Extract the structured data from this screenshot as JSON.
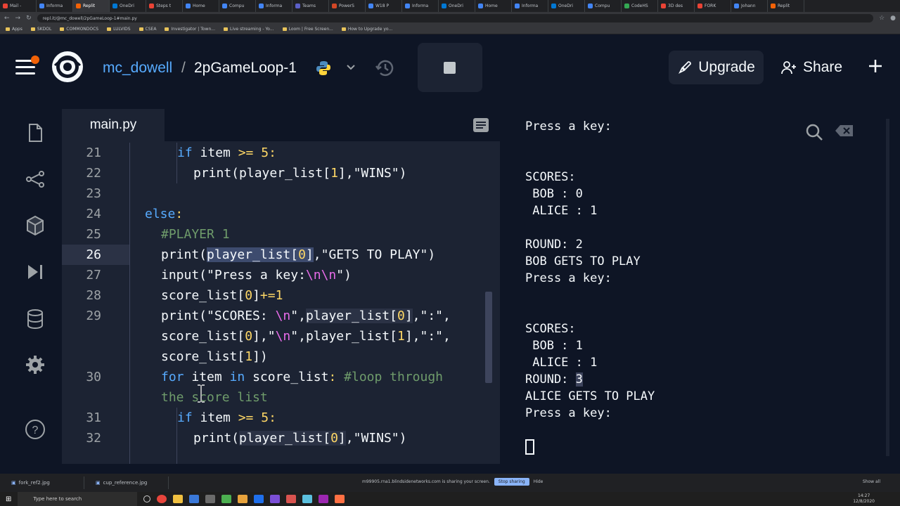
{
  "browser": {
    "tabs": [
      "Mail -",
      "Informa",
      "Replit",
      "OneDri",
      "Steps t",
      "Home",
      "Compu",
      "Informa",
      "Teams",
      "PowerS",
      "W18 P",
      "Informa",
      "OneDri",
      "Home",
      "Informa",
      "OneDri",
      "Compu",
      "CodeHS",
      "3D des",
      "FORK",
      "Johann",
      "Replit"
    ],
    "url": "repl.it/@mc_dowell/2pGameLoop-1#main.py",
    "bookmarks": [
      "Apps",
      "SKDOL",
      "COMMONDOCS",
      "LULVIDS",
      "CSEA",
      "Investigator | Town...",
      "Live streaming - Yo...",
      "Loom | Free Screen...",
      "How to Upgrade yo..."
    ]
  },
  "header": {
    "owner": "mc_dowell",
    "separator": "/",
    "repl_name": "2pGameLoop-1",
    "upgrade_label": "Upgrade",
    "share_label": "Share"
  },
  "editor": {
    "filename": "main.py",
    "active_line": 26
  },
  "console": {
    "output": "Press a key:\n\n\nSCORES:\n BOB : 0\n ALICE : 1\n\nROUND: 2\nBOB GETS TO PLAY\nPress a key:\n\n\nSCORES:\n BOB : 1\n ALICE : 1\nROUND: ",
    "round_value": "3",
    "output_tail": "\nALICE GETS TO PLAY\nPress a key:"
  },
  "footer": {
    "downloads": [
      "fork_ref2.jpg",
      "cup_reference.jpg"
    ],
    "share_notice": "m99905.rna1.blindsidenetworks.com is sharing your screen.",
    "stop_sharing": "Stop sharing",
    "hide": "Hide",
    "show_all": "Show all",
    "taskbar_search": "Type here to search",
    "clock_time": "14:27",
    "clock_date": "12/8/2020"
  },
  "colors": {
    "background": "#0e1525",
    "panel": "#1c2333",
    "accent_blue": "#57abff",
    "notification": "#f26207"
  }
}
